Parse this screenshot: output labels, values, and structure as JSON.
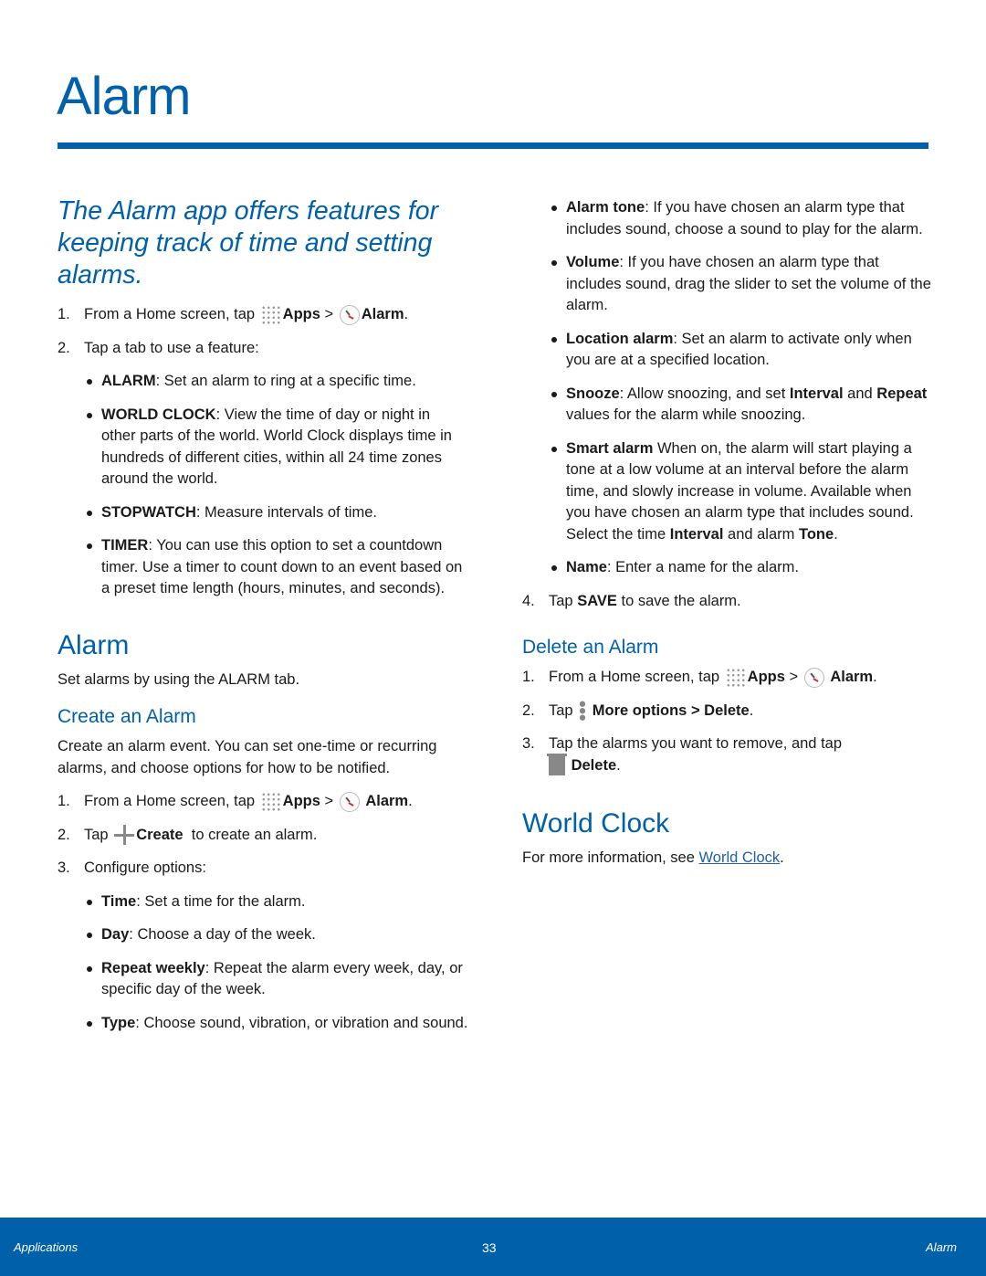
{
  "page": {
    "title": "Alarm",
    "intro": "The Alarm app offers features for keeping track of time and setting alarms."
  },
  "left": {
    "steps_open": [
      {
        "num": "1.",
        "pre": "From a Home screen, tap ",
        "apps": "Apps",
        "sep": " > ",
        "alarm": "Alarm",
        "end": "."
      },
      {
        "num": "2.",
        "text": "Tap a tab to use a feature:"
      }
    ],
    "tabs": [
      {
        "term": "ALARM",
        "text": ": Set an alarm to ring at a specific time."
      },
      {
        "term": "WORLD CLOCK",
        "text": ": View the time of day or night in other parts of the world. World Clock displays time in hundreds of different cities, within all 24 time zones around the world."
      },
      {
        "term": "STOPWATCH",
        "text": ": Measure intervals of time."
      },
      {
        "term": "TIMER",
        "text": ": You can use this option to set a countdown timer. Use a timer to count down to an event based on a preset time length (hours, minutes, and seconds)."
      }
    ],
    "alarm_heading": "Alarm",
    "alarm_text": "Set alarms by using the ALARM tab.",
    "create_heading": "Create an Alarm",
    "create_text": "Create an alarm event. You can set one-time or recurring alarms, and choose options for how to be notified.",
    "create_steps": [
      {
        "num": "1.",
        "pre": "From a Home screen, tap ",
        "apps": "Apps",
        "sep": " > ",
        "alarm": "Alarm",
        "end": "."
      },
      {
        "num": "2.",
        "pre": "Tap ",
        "create": "Create",
        "post": "  to create an alarm."
      },
      {
        "num": "3.",
        "text": "Configure options:"
      }
    ],
    "options": [
      {
        "term": "Time",
        "text": ": Set a time for the alarm."
      },
      {
        "term": "Day",
        "text": ": Choose a day of the week."
      },
      {
        "term": "Repeat weekly",
        "text": ": Repeat the alarm every week, day, or specific day of the week."
      },
      {
        "term": "Type",
        "text": ": Choose sound, vibration, or vibration and sound."
      }
    ]
  },
  "right": {
    "options": [
      {
        "term": "Alarm tone",
        "text": ": If you have chosen an alarm type that includes sound, choose a sound to play for the alarm."
      },
      {
        "term": "Volume",
        "text": ": If you have chosen an alarm type that includes sound, drag the slider to set the volume of the alarm."
      },
      {
        "term": "Location alarm",
        "text": ": Set an alarm to activate only when you are at a specified location."
      }
    ],
    "snooze": {
      "term": "Snooze",
      "t1": ": Allow snoozing, and set ",
      "b1": "Interval",
      "t2": " and ",
      "b2": "Repeat",
      "t3": " values for the alarm while snoozing."
    },
    "smart": {
      "term": "Smart alarm",
      "t1": " When on, the alarm will start playing a tone at a low volume at an interval before the alarm time, and slowly increase in volume. Available when you have chosen an alarm type that includes sound. Select the time ",
      "b1": "Interval",
      "t2": " and alarm ",
      "b2": "Tone",
      "t3": "."
    },
    "name": {
      "term": "Name",
      "text": ": Enter a name for the alarm."
    },
    "step4": {
      "num": "4.",
      "pre": "Tap ",
      "bold": "SAVE",
      "post": " to save the alarm."
    },
    "delete_heading": "Delete an Alarm",
    "delete_steps": {
      "s1": {
        "num": "1.",
        "pre": "From a Home screen, tap ",
        "apps": "Apps",
        "sep": " > ",
        "alarm": "Alarm",
        "end": "."
      },
      "s2": {
        "num": "2.",
        "pre": "Tap ",
        "b1": "More options",
        "sep": " > ",
        "b2": "Delete",
        "end": "."
      },
      "s3": {
        "num": "3.",
        "pre": " Tap the alarms you want to remove, and tap",
        "b1": "Delete",
        "end": "."
      }
    },
    "world_heading": "World Clock",
    "world_pre": "For more information, see ",
    "world_link": "World Clock",
    "world_end": "."
  },
  "footer": {
    "left": "Applications",
    "page": "33",
    "right": "Alarm"
  },
  "colors": {
    "accent": "#0060aa",
    "link": "#1f5fa8"
  }
}
